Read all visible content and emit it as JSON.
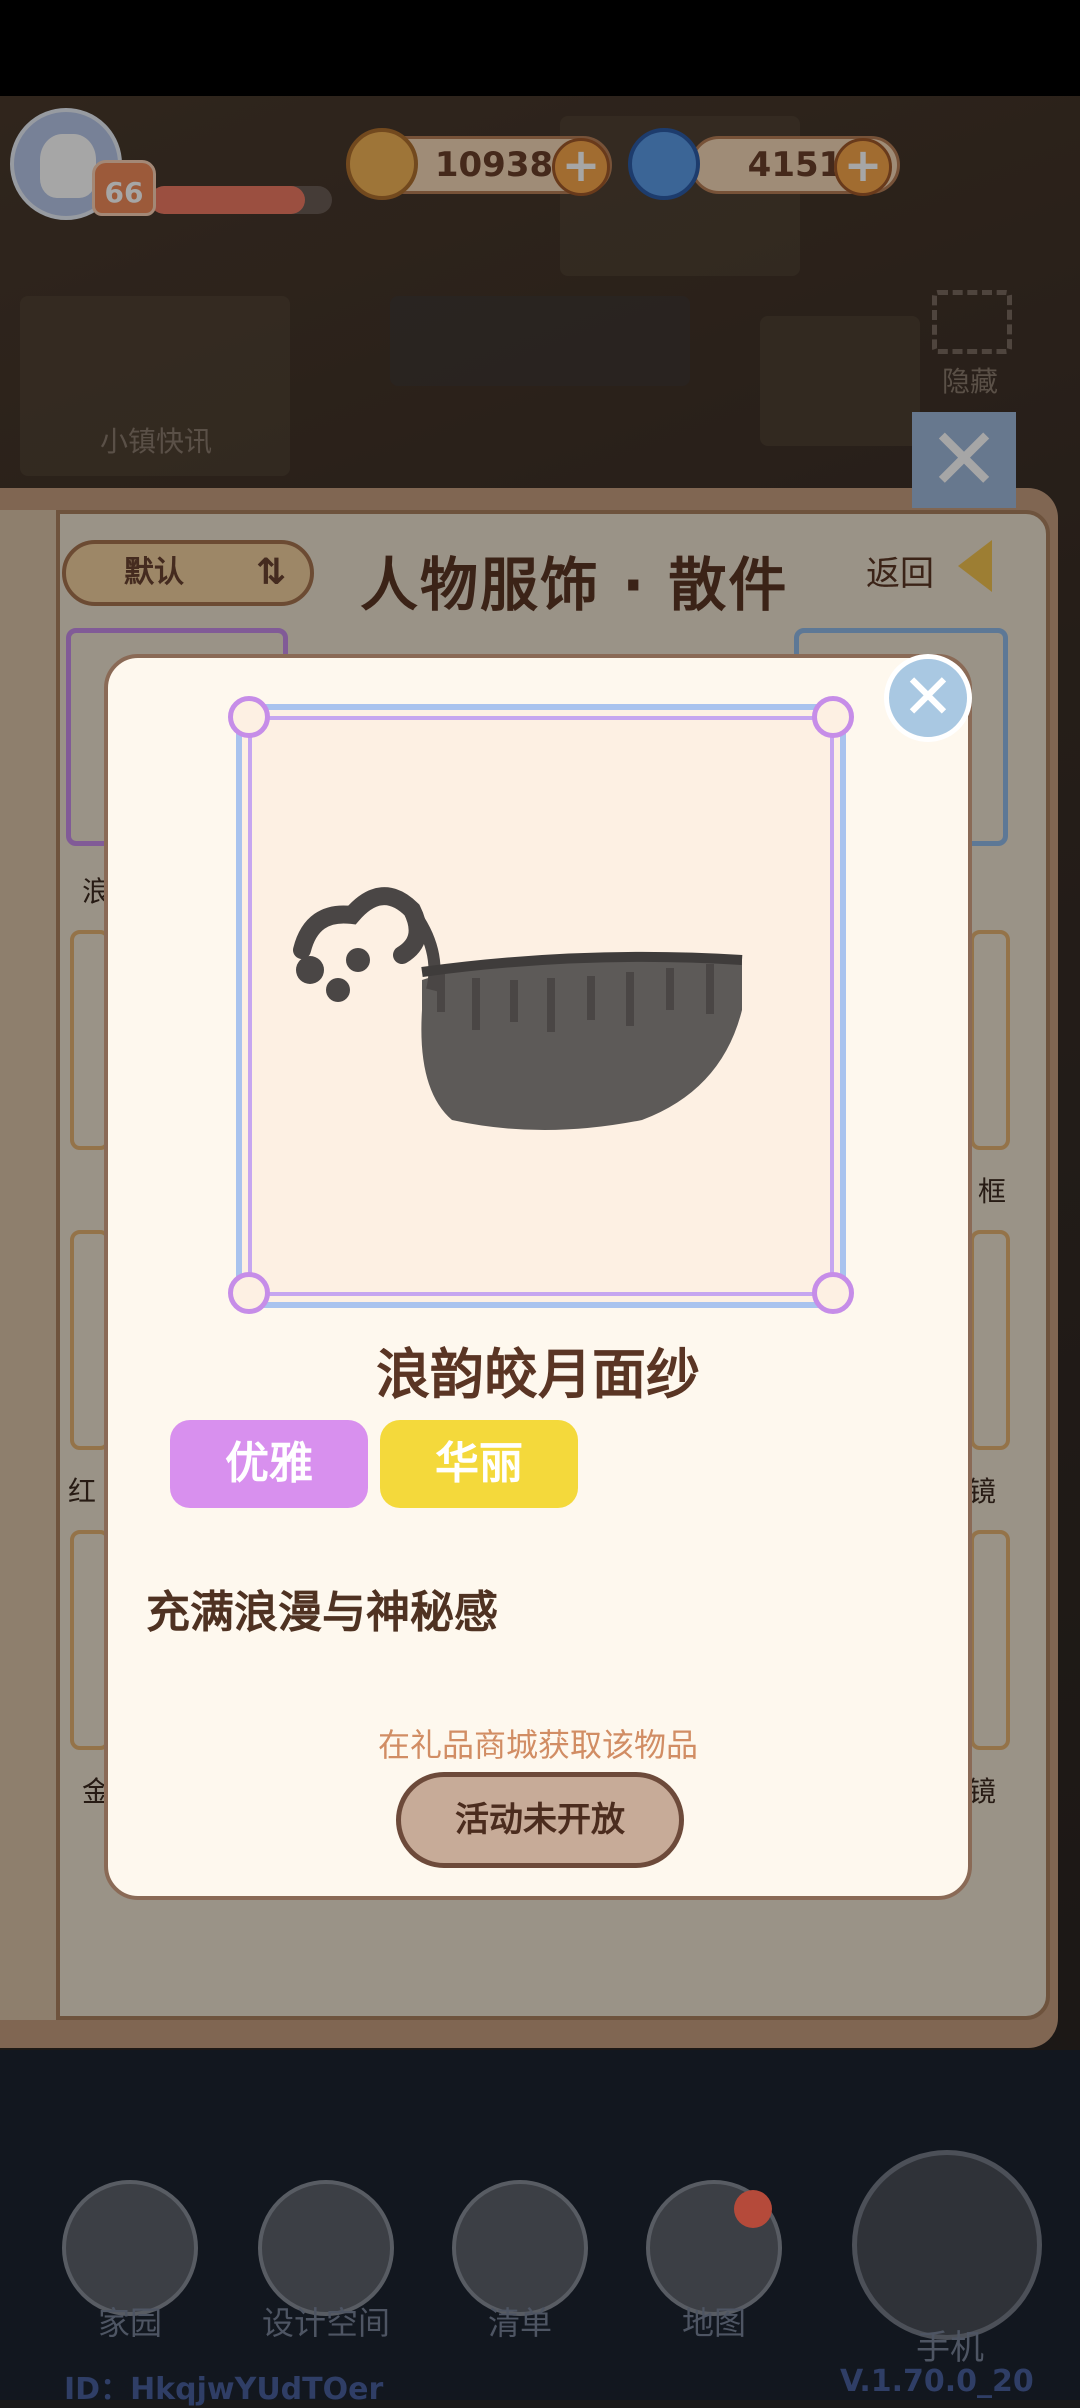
{
  "hud": {
    "level": "66",
    "xp_fraction": 0.85,
    "coins": "10938",
    "gems": "4151",
    "news_label": "小镇快讯",
    "hide_label": "隐藏"
  },
  "book": {
    "sort_label": "默认",
    "title": "人物服饰 · 散件",
    "back_label": "返回",
    "grid_fragments": [
      "浪",
      "框",
      "红",
      "镜",
      "金",
      "镜"
    ]
  },
  "modal": {
    "item_name": "浪韵皎月面纱",
    "tags": [
      {
        "label": "优雅",
        "color": "#d890ee"
      },
      {
        "label": "华丽",
        "color": "#f4d93b"
      }
    ],
    "description": "充满浪漫与神秘感",
    "source_text": "在礼品商城获取该物品",
    "action_label": "活动未开放"
  },
  "nav": {
    "items": [
      {
        "label": "家园",
        "icon": "home-icon"
      },
      {
        "label": "设计空间",
        "icon": "design-icon"
      },
      {
        "label": "清单",
        "icon": "list-icon"
      },
      {
        "label": "地图",
        "icon": "map-pin-icon"
      }
    ],
    "phone_label": "手机",
    "user_id": "ID：HkqjwYUdTOer",
    "version": "V.1.70.0_20"
  }
}
